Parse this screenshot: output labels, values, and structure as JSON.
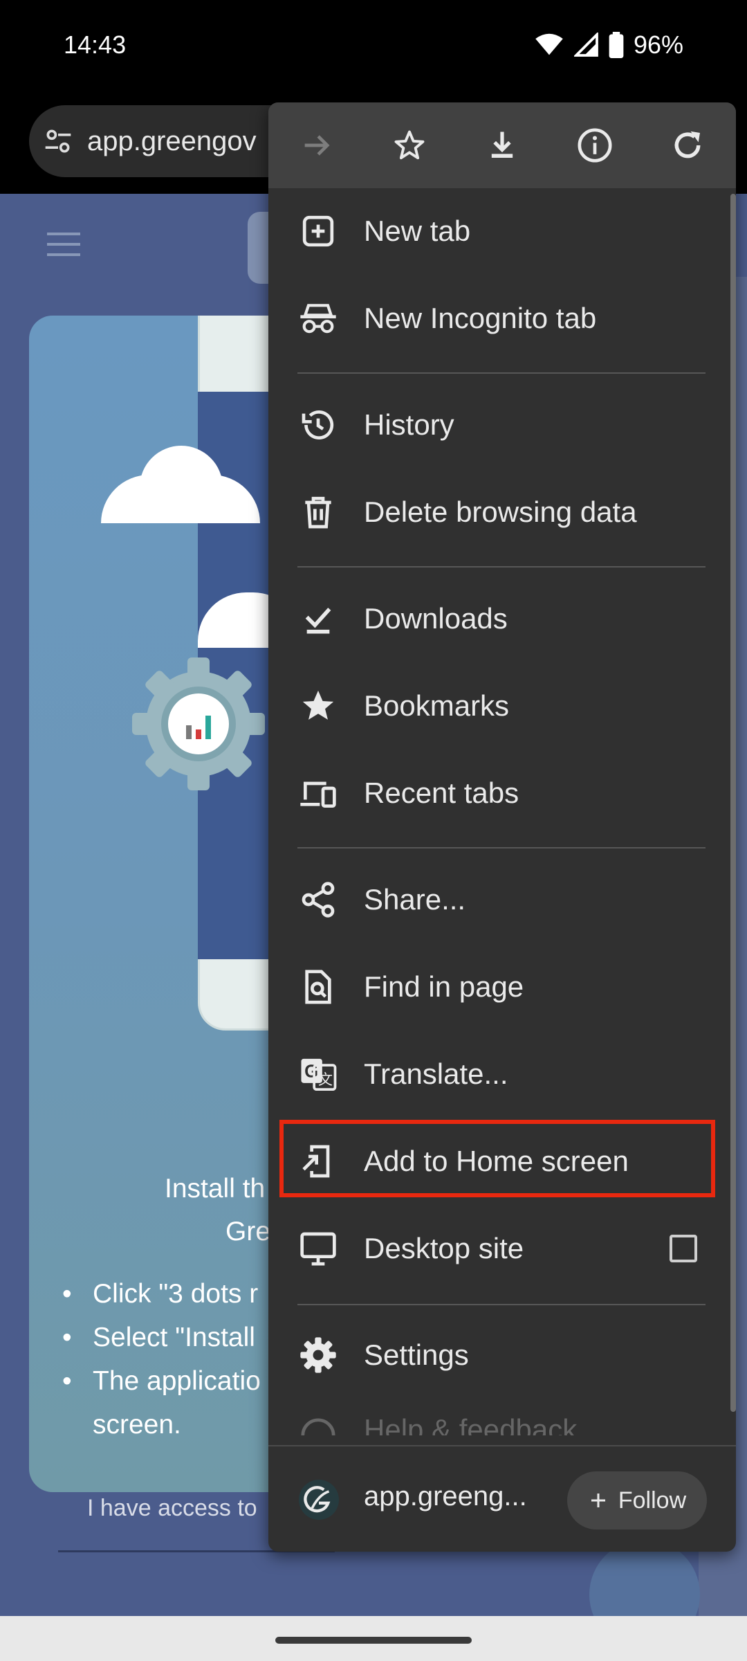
{
  "status_bar": {
    "time": "14:43",
    "battery": "96%"
  },
  "browser": {
    "url": "app.greengov"
  },
  "page": {
    "install_line1": "Install th",
    "install_line2": "Gre",
    "bullets": [
      "Click \"3 dots r",
      "Select \"Install",
      "The applicatio"
    ],
    "bullet_continuation": "screen.",
    "access_text": "I have access to"
  },
  "menu": {
    "top_icons": [
      "forward-icon",
      "star-icon",
      "download-icon",
      "info-icon",
      "refresh-icon"
    ],
    "items": {
      "new_tab": "New tab",
      "new_incognito_tab": "New Incognito tab",
      "history": "History",
      "delete_browsing_data": "Delete browsing data",
      "downloads": "Downloads",
      "bookmarks": "Bookmarks",
      "recent_tabs": "Recent tabs",
      "share": "Share...",
      "find_in_page": "Find in page",
      "translate": "Translate...",
      "add_to_home_screen": "Add to Home screen",
      "desktop_site": "Desktop site",
      "settings": "Settings",
      "help_feedback": "Help & feedback"
    },
    "footer": {
      "site": "app.greeng...",
      "follow": "Follow"
    },
    "highlight_color": "#e8280f"
  }
}
